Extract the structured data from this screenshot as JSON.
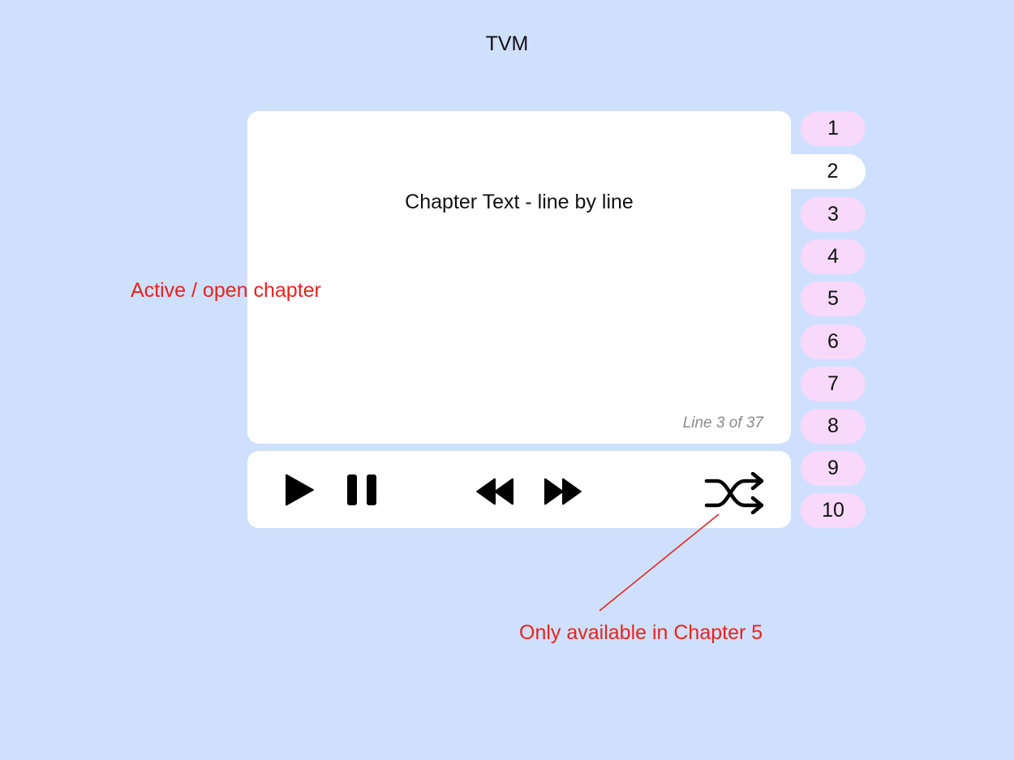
{
  "app": {
    "title": "TVM"
  },
  "reader": {
    "chapter_text": "Chapter Text - line by line",
    "line_counter": "Line 3 of 37"
  },
  "controls": {
    "icons": [
      "play-icon",
      "pause-icon",
      "rewind-icon",
      "fast-forward-icon",
      "shuffle-icon"
    ]
  },
  "chapters": {
    "active_index": 1,
    "items": [
      {
        "label": "1"
      },
      {
        "label": "2"
      },
      {
        "label": "3"
      },
      {
        "label": "4"
      },
      {
        "label": "5"
      },
      {
        "label": "6"
      },
      {
        "label": "7"
      },
      {
        "label": "8"
      },
      {
        "label": "9"
      },
      {
        "label": "10"
      }
    ]
  },
  "annotations": {
    "active_chapter": "Active / open chapter",
    "shuffle_note": "Only available in Chapter 5"
  },
  "colors": {
    "background": "#cfe0fd",
    "panel": "#ffffff",
    "tab": "#f8d9fb",
    "annotation": "#e8231d"
  }
}
